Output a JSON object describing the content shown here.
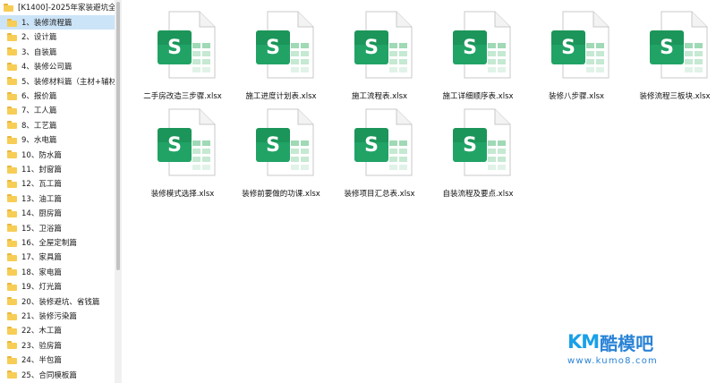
{
  "sidebar": {
    "root_label": "[K1400]-2025年家装避坑全流",
    "items": [
      {
        "label": "1、装修流程篇"
      },
      {
        "label": "2、设计篇"
      },
      {
        "label": "3、自装篇"
      },
      {
        "label": "4、装修公司篇"
      },
      {
        "label": "5、装修材料篇（主材+辅材"
      },
      {
        "label": "6、报价篇"
      },
      {
        "label": "7、工人篇"
      },
      {
        "label": "8、工艺篇"
      },
      {
        "label": "9、水电篇"
      },
      {
        "label": "10、防水篇"
      },
      {
        "label": "11、封窗篇"
      },
      {
        "label": "12、瓦工篇"
      },
      {
        "label": "13、油工篇"
      },
      {
        "label": "14、厨房篇"
      },
      {
        "label": "15、卫浴篇"
      },
      {
        "label": "16、全屋定制篇"
      },
      {
        "label": "17、家具篇"
      },
      {
        "label": "18、家电篇"
      },
      {
        "label": "19、灯光篇"
      },
      {
        "label": "20、装修避坑、省钱篇"
      },
      {
        "label": "21、装修污染篇"
      },
      {
        "label": "22、木工篇"
      },
      {
        "label": "23、验房篇"
      },
      {
        "label": "24、半包篇"
      },
      {
        "label": "25、合同模板篇"
      }
    ],
    "selected_index": 0
  },
  "files": [
    {
      "name": "二手房改造三步骤.xlsx",
      "icon": "spreadsheet-icon"
    },
    {
      "name": "施工进度计划表.xlsx",
      "icon": "spreadsheet-icon"
    },
    {
      "name": "施工流程表.xlsx",
      "icon": "spreadsheet-icon"
    },
    {
      "name": "施工详细顺序表.xlsx",
      "icon": "spreadsheet-icon"
    },
    {
      "name": "装修八步骤.xlsx",
      "icon": "spreadsheet-icon"
    },
    {
      "name": "装修流程三板块.xlsx",
      "icon": "spreadsheet-icon"
    },
    {
      "name": "装修模式选择.xlsx",
      "icon": "spreadsheet-icon"
    },
    {
      "name": "装修前要做的功课.xlsx",
      "icon": "spreadsheet-icon"
    },
    {
      "name": "装修项目汇总表.xlsx",
      "icon": "spreadsheet-icon"
    },
    {
      "name": "自装流程及要点.xlsx",
      "icon": "spreadsheet-icon"
    }
  ],
  "icon_glyph": "S",
  "colors": {
    "icon_green_dark": "#107c41",
    "icon_green": "#21a366",
    "selection": "#cce4f7",
    "folder": "#f7cd55",
    "watermark": "#1aa0e8"
  },
  "watermark": {
    "brand_latin": "KM",
    "brand_cn": "酷模吧",
    "url": "www.kumo8.com"
  }
}
